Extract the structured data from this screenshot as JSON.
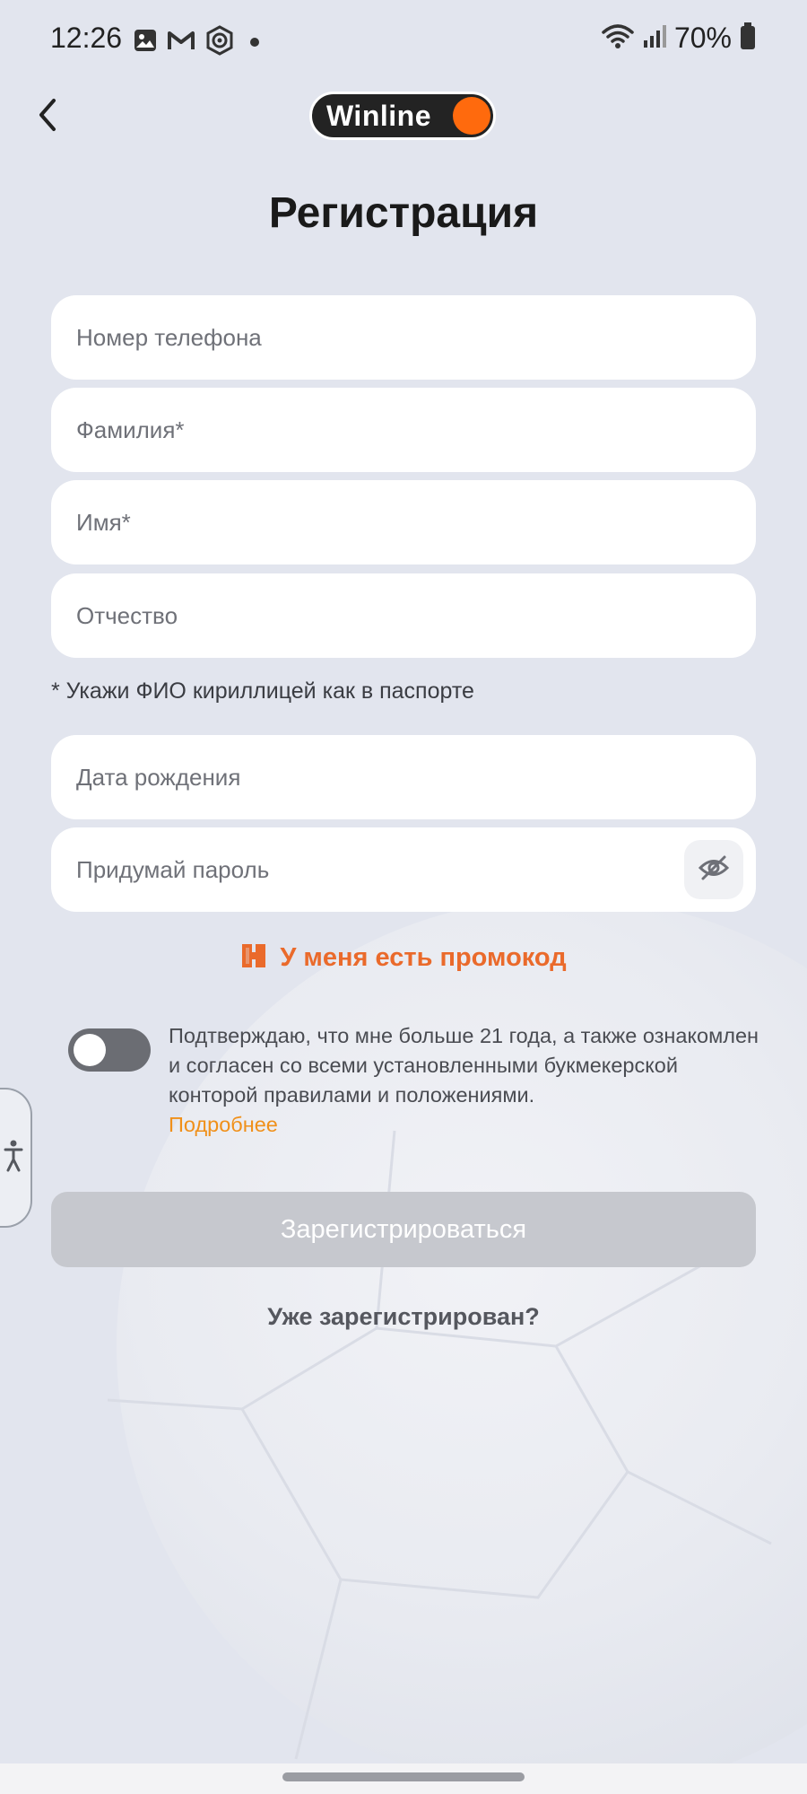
{
  "status_bar": {
    "time": "12:26",
    "notification_icons": [
      "image-icon",
      "gmail-icon",
      "shield-app-icon",
      "dot-icon"
    ],
    "battery_percent": "70%"
  },
  "header": {
    "back_icon": "chevron-left-icon",
    "logo_text": "Winline",
    "title": "Регистрация"
  },
  "form": {
    "phone_placeholder": "Номер телефона",
    "surname_placeholder": "Фамилия*",
    "name_placeholder": "Имя*",
    "patronymic_placeholder": "Отчество",
    "fio_hint": "* Укажи ФИО кириллицей как в паспорте",
    "birthdate_placeholder": "Дата рождения",
    "password_placeholder": "Придумай пароль",
    "password_visibility_icon": "eye-off-icon"
  },
  "promo": {
    "label": "У меня есть промокод",
    "icon": "promo-icon"
  },
  "consent": {
    "toggle_on": false,
    "text": "Подтверждаю, что мне больше 21 года, а также ознакомлен и согласен со всеми установленными букмекерской конторой правилами и положениями.",
    "more_label": "Подробнее"
  },
  "actions": {
    "register_label": "Зарегистрироваться",
    "register_enabled": false,
    "login_label": "Уже зарегистрирован?"
  },
  "colors": {
    "accent_orange": "#ea6a2b",
    "link_yellow_orange": "#f0901a",
    "logo_dot": "#ff6a0d",
    "background": "#e2e5ee"
  }
}
